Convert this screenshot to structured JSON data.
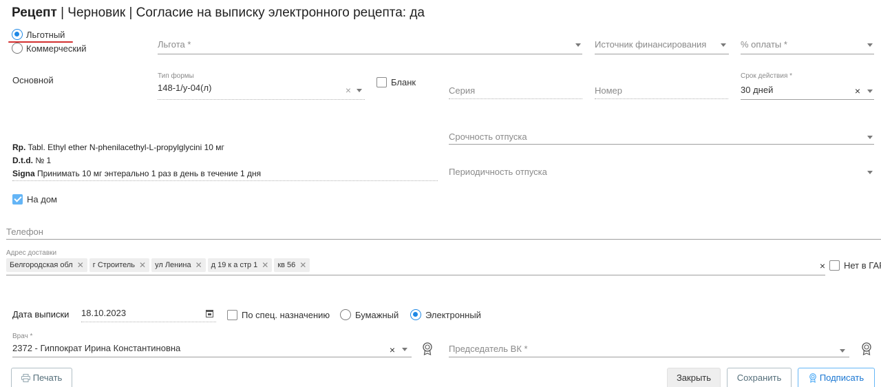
{
  "header": {
    "title_bold": "Рецепт",
    "title_rest": " | Черновик | Согласие на выписку электронного рецепта: да"
  },
  "recipe_type": {
    "options": [
      "Льготный",
      "Коммерческий"
    ],
    "selected": "Льготный"
  },
  "lgota": {
    "placeholder": "Льгота *"
  },
  "funding": {
    "placeholder": "Источник финансирования"
  },
  "payment": {
    "placeholder": "% оплаты *"
  },
  "section": {
    "label": "Основной"
  },
  "form_type": {
    "label": "Тип формы",
    "value": "148-1/у-04(л)"
  },
  "blank": {
    "label": "Бланк",
    "checked": false
  },
  "series": {
    "placeholder": "Серия"
  },
  "number": {
    "placeholder": "Номер"
  },
  "validity": {
    "label": "Срок действия *",
    "value": "30 дней"
  },
  "urgency": {
    "placeholder": "Срочность отпуска"
  },
  "periodicity": {
    "placeholder": "Периодичность отпуска"
  },
  "prescription": {
    "rp_label": "Rp.",
    "rp_text": " Tabl. Ethyl ether N-phenilacethyl-L-propylglycini 10 мг",
    "dtd_label": "D.t.d.",
    "dtd_text": " № 1",
    "signa_label": "Signa",
    "signa_text": " Принимать 10 мг энтерально 1 раз в день в течение 1 дня"
  },
  "home": {
    "label": "На дом",
    "checked": true
  },
  "phone": {
    "placeholder": "Телефон"
  },
  "address": {
    "label": "Адрес доставки",
    "chips": [
      "Белгородская обл",
      "г Строитель",
      "ул Ленина",
      "д 19 к а стр 1",
      "кв 56"
    ],
    "no_gar_label": "Нет в ГАР"
  },
  "issue_date": {
    "label": "Дата выписки",
    "value": "18.10.2023"
  },
  "special": {
    "label": "По спец. назначению",
    "checked": false
  },
  "medium": {
    "options": [
      "Бумажный",
      "Электронный"
    ],
    "selected": "Электронный"
  },
  "doctor": {
    "label": "Врач *",
    "value": "2372 - Гиппократ Ирина Константиновна"
  },
  "chairman": {
    "placeholder": "Председатель ВК *"
  },
  "buttons": {
    "print": "Печать",
    "close": "Закрыть",
    "save": "Сохранить",
    "sign": "Подписать"
  },
  "colors": {
    "accent": "#1e88e5",
    "underline_red": "#d32f2f",
    "checkbox": "#64b5f6"
  },
  "icons": [
    "print-icon",
    "calendar-icon",
    "certificate-icon",
    "chevron-down-icon",
    "close-icon"
  ]
}
